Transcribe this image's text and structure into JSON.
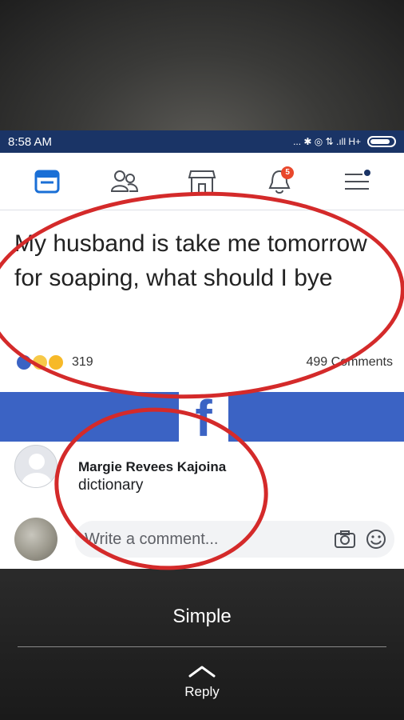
{
  "status_bar": {
    "time": "8:58 AM",
    "indicators": "... ✱ ◎ ⇅ .ıll H+"
  },
  "nav": {
    "items": [
      {
        "icon": "news-feed-icon"
      },
      {
        "icon": "friends-icon"
      },
      {
        "icon": "marketplace-icon"
      },
      {
        "icon": "notifications-icon",
        "badge": "5"
      },
      {
        "icon": "menu-icon"
      }
    ]
  },
  "post": {
    "text": "My husband is take me tomorrow for soaping, what should I bye",
    "reaction_count": "319",
    "comment_count": "499 Comments"
  },
  "comment": {
    "author": "Margie Revees Kajoina",
    "text": "dictionary"
  },
  "composer": {
    "placeholder": "Write a comment..."
  },
  "overlay": {
    "caption": "Simple",
    "reply_label": "Reply"
  },
  "colors": {
    "facebook_blue": "#3b63c4",
    "status_bar": "#1a3466",
    "annotation_red": "#d42a2a",
    "badge_red": "#e9482c"
  }
}
